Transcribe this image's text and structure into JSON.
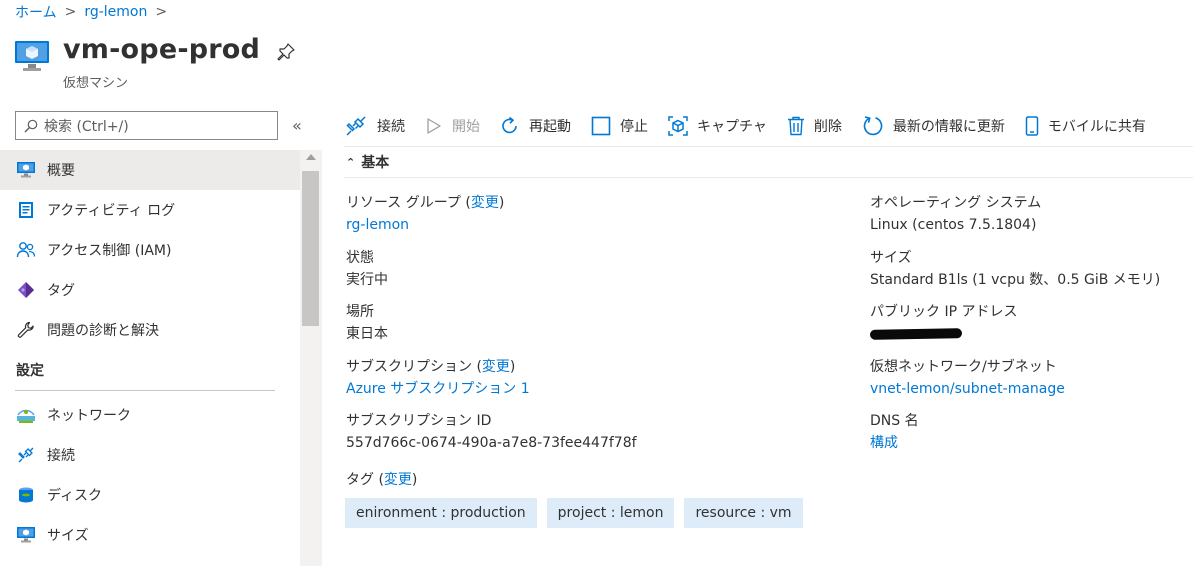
{
  "breadcrumb": [
    {
      "label": "ホーム"
    },
    {
      "label": "rg-lemon"
    }
  ],
  "header": {
    "title": "vm-ope-prod",
    "subtitle": "仮想マシン"
  },
  "sidebar": {
    "search_placeholder": "検索 (Ctrl+/)",
    "collapse_label": "«",
    "items": [
      {
        "label": "概要",
        "icon": "vm-monitor-icon",
        "active": true
      },
      {
        "label": "アクティビティ ログ",
        "icon": "activity-log-icon"
      },
      {
        "label": "アクセス制御 (IAM)",
        "icon": "people-icon"
      },
      {
        "label": "タグ",
        "icon": "tag-icon"
      },
      {
        "label": "問題の診断と解決",
        "icon": "wrench-icon"
      }
    ],
    "section_settings": "設定",
    "settings_items": [
      {
        "label": "ネットワーク",
        "icon": "network-icon"
      },
      {
        "label": "接続",
        "icon": "connect-icon"
      },
      {
        "label": "ディスク",
        "icon": "disk-icon"
      },
      {
        "label": "サイズ",
        "icon": "vm-monitor-icon"
      }
    ]
  },
  "toolbar": {
    "connect": "接続",
    "start": "開始",
    "restart": "再起動",
    "stop": "停止",
    "capture": "キャプチャ",
    "delete": "削除",
    "refresh": "最新の情報に更新",
    "mobile": "モバイルに共有"
  },
  "essentials": {
    "heading": "基本",
    "change_link": "変更",
    "resource_group_label": "リソース グループ",
    "resource_group_value": "rg-lemon",
    "status_label": "状態",
    "status_value": "実行中",
    "location_label": "場所",
    "location_value": "東日本",
    "subscription_label": "サブスクリプション",
    "subscription_value": "Azure サブスクリプション 1",
    "subscription_id_label": "サブスクリプション ID",
    "subscription_id_value": "557d766c-0674-490a-a7e8-73fee447f78f",
    "os_label": "オペレーティング システム",
    "os_value": "Linux (centos 7.5.1804)",
    "size_label": "サイズ",
    "size_value": "Standard B1ls (1 vcpu 数、0.5 GiB メモリ)",
    "public_ip_label": "パブリック IP アドレス",
    "vnet_label": "仮想ネットワーク/サブネット",
    "vnet_value": "vnet-lemon/subnet-manage",
    "dns_label": "DNS 名",
    "dns_value": "構成",
    "tags_label": "タグ",
    "tags": [
      "enironment : production",
      "project : lemon",
      "resource : vm"
    ]
  },
  "colors": {
    "link": "#0078d4",
    "tag_bg": "#deecf9",
    "active_nav_bg": "#edebe9",
    "icon_blue": "#0078d4"
  }
}
